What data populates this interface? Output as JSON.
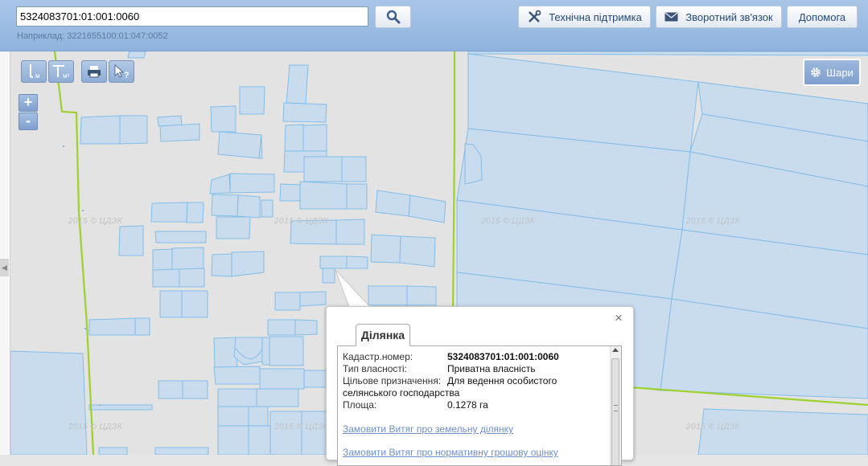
{
  "search": {
    "value": "5324083701:01:001:0060",
    "example": "Наприклад: 3221655100:01:047:0052"
  },
  "header_buttons": {
    "support": "Технічна підтримка",
    "feedback": "Зворотний зв'язок",
    "help": "Допомога"
  },
  "map_controls": {
    "distance_unit": "м",
    "area_unit": "м²",
    "zoom_in": "+",
    "zoom_out": "-",
    "layers": "Шари",
    "watermark": "2015 © ЦДЗК"
  },
  "popup": {
    "tab": "Ділянка",
    "close": "×",
    "fields": [
      {
        "label": "Кадастр.номер:",
        "value": "5324083701:01:001:0060"
      },
      {
        "label": "Тип власності:",
        "value": "Приватна власність"
      },
      {
        "label": "Цільове призначення:",
        "value": "Для ведення особистого селянського господарства"
      },
      {
        "label": "Площа:",
        "value": "0.1278 га"
      }
    ],
    "links": [
      "Замовити Витяг про земельну ділянку",
      "Замовити Витяг про нормативну грошову оцінку"
    ]
  },
  "colors": {
    "parcel_fill": "#c6dbef",
    "parcel_stroke": "#7fbbe6",
    "road": "#9ed12d",
    "header": "#a9c6e8"
  }
}
